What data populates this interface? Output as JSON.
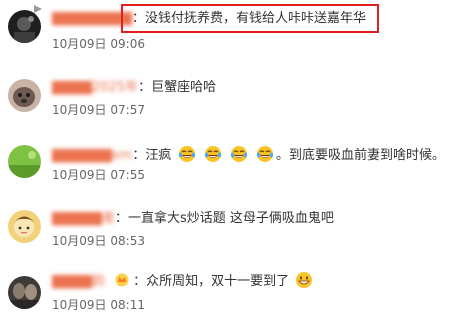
{
  "comments": [
    {
      "username": "▇▇▇▇▇▇▇▇",
      "separator": "：",
      "text": "没钱付抚养费，有钱给人咔咔送嘉年华",
      "date": "10月09日",
      "time": "09:06",
      "avatar_icon": "dark-avatar-icon"
    },
    {
      "username": "▇▇▇▇2025年",
      "separator": "：",
      "text": "巨蟹座哈哈",
      "date": "10月09日",
      "time": "07:57",
      "avatar_icon": "dog-avatar-icon"
    },
    {
      "username": "▇▇▇▇▇▇xm",
      "separator": "：",
      "text_before": "汪疯",
      "text_after": "。到底要吸血前妻到啥时候。",
      "date": "10月09日",
      "time": "07:55",
      "avatar_icon": "green-avatar-icon",
      "emoji_icon": "tears-of-joy-emoji-icon"
    },
    {
      "username": "▇▇▇▇▇者",
      "separator": "：",
      "text": "一直拿大s炒话题 这母子俩吸血鬼吧",
      "date": "10月09日",
      "time": "08:53",
      "avatar_icon": "cartoon-avatar-icon"
    },
    {
      "username": "▇▇▇▇韵",
      "separator": "：",
      "text": "众所周知，双十一要到了",
      "date": "10月09日",
      "time": "08:11",
      "avatar_icon": "photo-avatar-icon",
      "badge_icon": "crown-badge-icon",
      "emoji_icon": "grin-emoji-icon"
    }
  ],
  "colors": {
    "username": "#eb7350",
    "text": "#333333",
    "meta": "#666666",
    "highlight": "#e02020"
  }
}
